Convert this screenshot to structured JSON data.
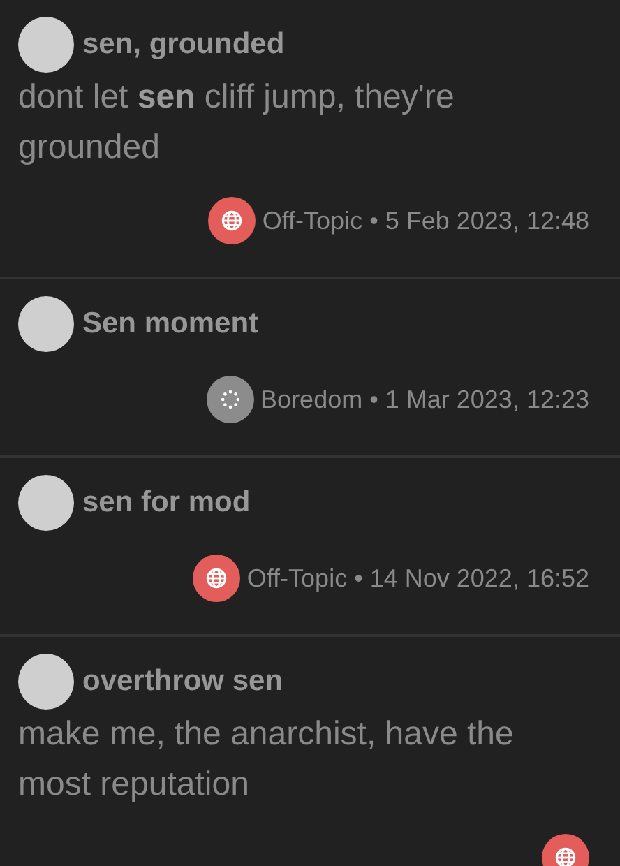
{
  "posts": [
    {
      "title": "sen, grounded",
      "body": "dont let **sen** cliff jump, they're grounded",
      "category": {
        "kind": "globe",
        "color": "#e35d5b"
      },
      "meta": "Off-Topic • 5 Feb 2023, 12:48"
    },
    {
      "title": "Sen moment",
      "category": {
        "kind": "dots",
        "color": "#8c8c8c"
      },
      "meta": "Boredom • 1 Mar 2023, 12:23"
    },
    {
      "title": "sen for mod",
      "category": {
        "kind": "globe",
        "color": "#e35d5b"
      },
      "meta": "Off-Topic • 14 Nov 2022, 16:52"
    },
    {
      "title": "overthrow sen",
      "body": "make me, the anarchist, have the most reputation",
      "category": {
        "kind": "globe",
        "color": "#e35d5b"
      }
    }
  ]
}
